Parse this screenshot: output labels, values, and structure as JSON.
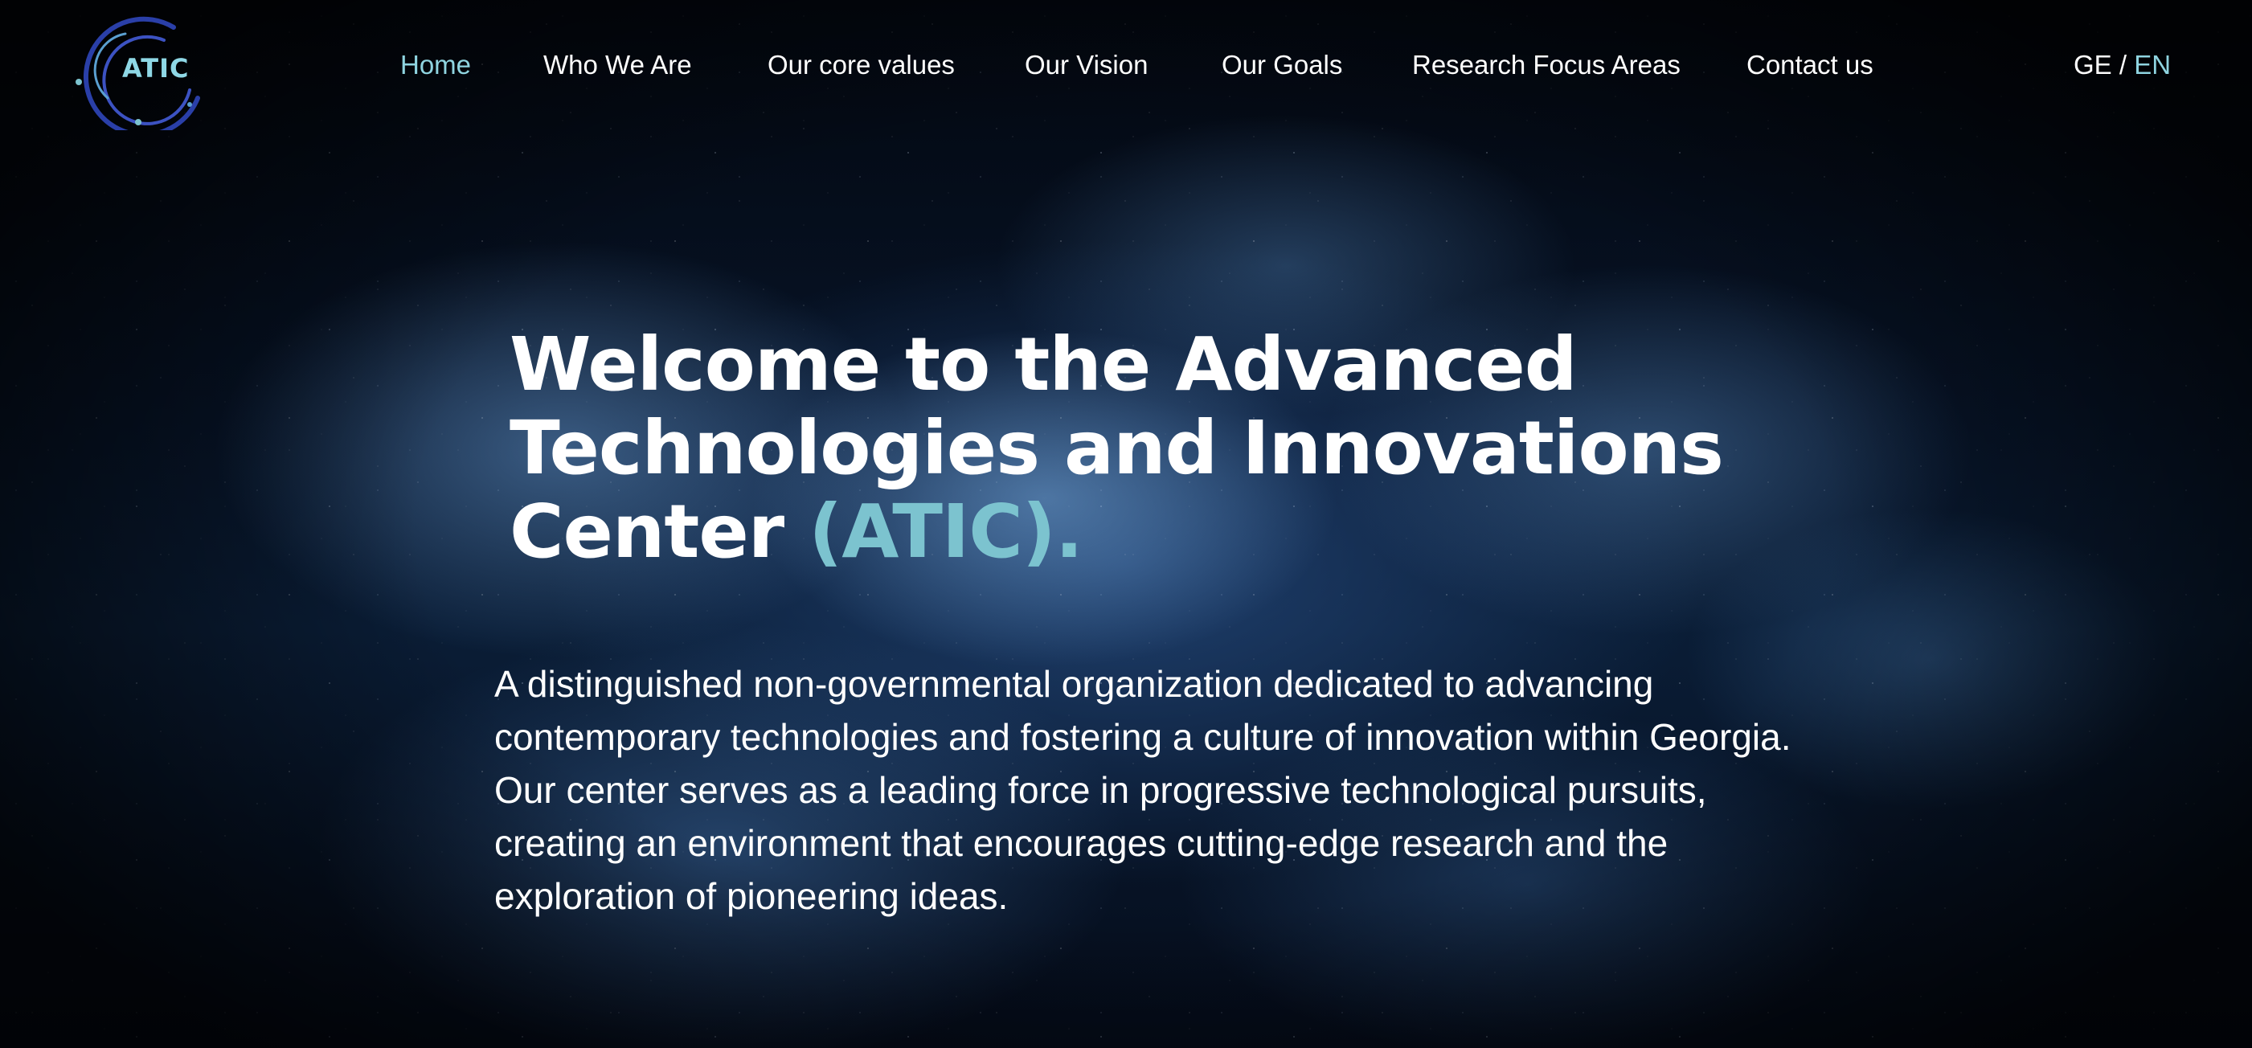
{
  "brand": {
    "logo_text": "ATIC",
    "accent_color": "#8fd4e0",
    "logo_ring_color": "#2a3fa8"
  },
  "nav": {
    "items": [
      {
        "label": "Home",
        "active": true
      },
      {
        "label": "Who We Are",
        "active": false
      },
      {
        "label": "Our core values",
        "active": false
      },
      {
        "label": "Our Vision",
        "active": false
      },
      {
        "label": "Our Goals",
        "active": false
      },
      {
        "label": "Research Focus Areas",
        "active": false
      },
      {
        "label": "Contact us",
        "active": false
      }
    ]
  },
  "language": {
    "ge": "GE",
    "separator": " / ",
    "en": "EN",
    "selected": "EN"
  },
  "hero": {
    "title_main": "Welcome to the Advanced Technologies and Innovations Center ",
    "title_accent": "(ATIC).",
    "description": "A distinguished non-governmental organization dedicated to advancing contemporary technologies and fostering a culture of innovation within Georgia. Our center serves as a leading force in progressive technological pursuits, creating an environment that encourages cutting-edge research and the exploration of pioneering ideas."
  }
}
